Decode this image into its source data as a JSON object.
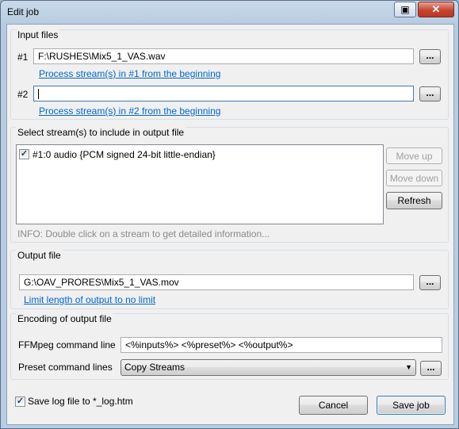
{
  "window": {
    "title": "Edit job"
  },
  "input_files": {
    "group_title": "Input files",
    "file1": {
      "label": "#1",
      "value": "F:\\RUSHES\\Mix5_1_VAS.wav",
      "browse": "...",
      "link": "Process stream(s) in #1 from the beginning"
    },
    "file2": {
      "label": "#2",
      "value": "",
      "browse": "...",
      "link": "Process stream(s) in #2 from the beginning"
    }
  },
  "streams": {
    "group_title": "Select stream(s) to include in output file",
    "items": [
      {
        "checked": true,
        "check_glyph": "✓",
        "label": "#1:0 audio {PCM signed 24-bit little-endian}"
      }
    ],
    "move_up": "Move up",
    "move_down": "Move down",
    "refresh": "Refresh",
    "info": "INFO: Double click on a stream to get detailed information..."
  },
  "output_file": {
    "group_title": "Output file",
    "value": "G:\\OAV_PRORES\\Mix5_1_VAS.mov",
    "browse": "...",
    "link": "Limit length of output to no limit"
  },
  "encoding": {
    "group_title": "Encoding of output file",
    "ffmpeg_label": "FFMpeg command line",
    "ffmpeg_value": "<%inputs%> <%preset%> <%output%>",
    "preset_label": "Preset command lines",
    "preset_value": "Copy Streams",
    "preset_browse": "..."
  },
  "footer": {
    "save_log_checked": true,
    "save_log_glyph": "✓",
    "save_log_label": "Save log file to *_log.htm",
    "cancel": "Cancel",
    "save_job": "Save job"
  },
  "titlebar_icons": {
    "restore": "restore-icon",
    "close": "close-icon"
  }
}
